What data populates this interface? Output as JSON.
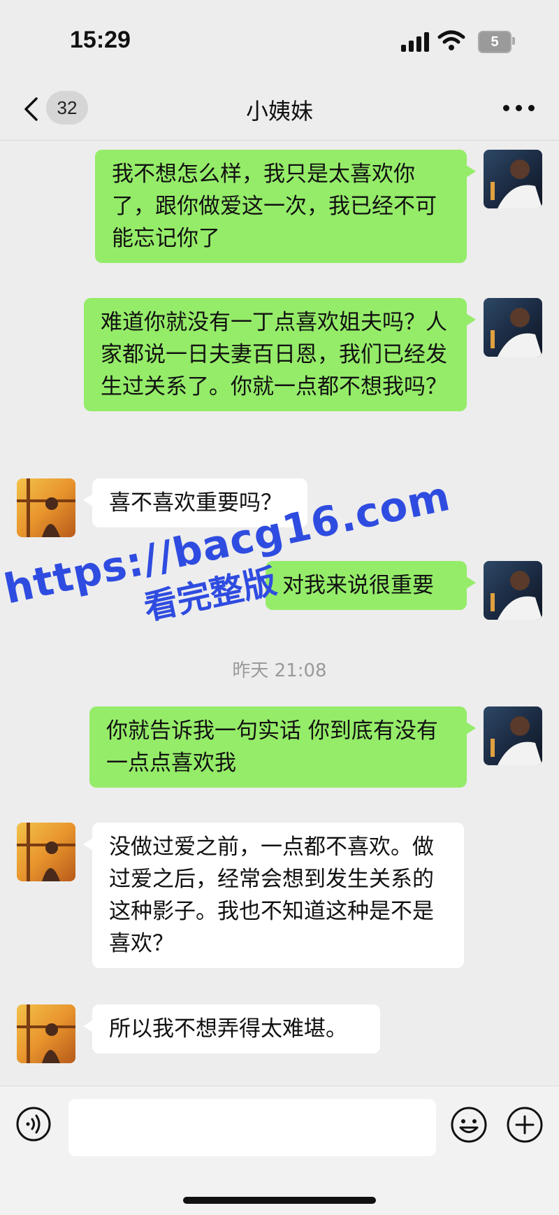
{
  "status_bar": {
    "time": "15:29",
    "battery": "5"
  },
  "nav": {
    "unread_count": "32",
    "title": "小姨妹"
  },
  "messages": [
    {
      "side": "out",
      "text": "我不想怎么样，我只是太喜欢你了，跟你做爱这一次，我已经不可能忘记你了"
    },
    {
      "side": "out",
      "text": "难道你就没有一丁点喜欢姐夫吗？人家都说一日夫妻百日恩，我们已经发生过关系了。你就一点都不想我吗？"
    },
    {
      "side": "in",
      "text": "喜不喜欢重要吗？"
    },
    {
      "side": "out",
      "text": "对我来说很重要"
    },
    {
      "side": "out",
      "text": "你就告诉我一句实话 你到底有没有一点点喜欢我"
    },
    {
      "side": "in",
      "text": "没做过爱之前，一点都不喜欢。做过爱之后，经常会想到发生关系的这种影子。我也不知道这种是不是喜欢？"
    },
    {
      "side": "in",
      "text": "所以我不想弄得太难堪。"
    }
  ],
  "timestamp": "昨天 21:08",
  "watermark": {
    "url": "https://bacg16.com",
    "sub": "看完整版"
  },
  "colors": {
    "outgoing_bubble": "#95ec69",
    "incoming_bubble": "#ffffff",
    "background": "#ededed",
    "watermark": "#2f4ce0"
  },
  "icons": [
    "back-icon",
    "more-icon",
    "voice-icon",
    "emoji-icon",
    "plus-icon"
  ]
}
